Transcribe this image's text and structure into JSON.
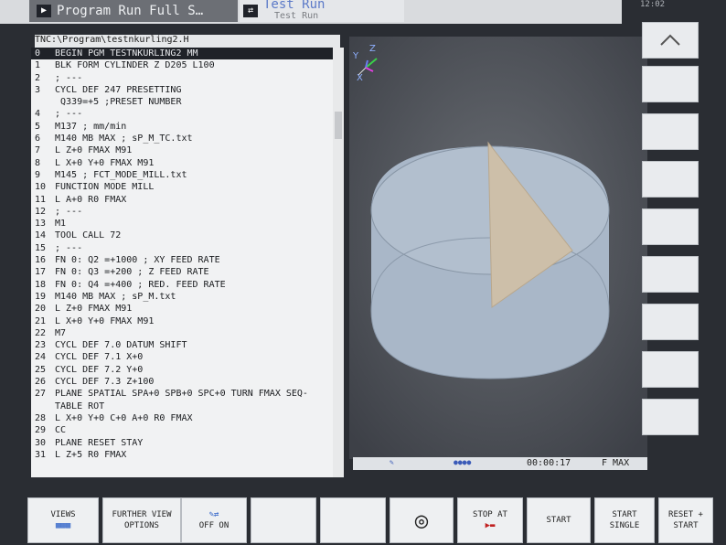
{
  "top": {
    "left_tab": "Program Run Full S…",
    "right_tab": "Test Run",
    "right_sub": "Test Run",
    "clock": "12:02"
  },
  "path": "TNC:\\Program\\testnkurling2.H",
  "program": [
    {
      "n": "0",
      "t": "BEGIN PGM TESTNKURLING2 MM",
      "sel": true
    },
    {
      "n": "1",
      "t": "BLK FORM CYLINDER Z D205 L100"
    },
    {
      "n": "2",
      "t": "; ---"
    },
    {
      "n": "3",
      "t": "CYCL DEF 247 PRESETTING"
    },
    {
      "n": "",
      "t": "  Q339=+5      ;PRESET NUMBER"
    },
    {
      "n": "4",
      "t": "; ---"
    },
    {
      "n": "5",
      "t": "M137 ; mm/min"
    },
    {
      "n": "6",
      "t": "M140 MB MAX ; sP_M_TC.txt"
    },
    {
      "n": "7",
      "t": "L  Z+0 FMAX M91"
    },
    {
      "n": "8",
      "t": "L  X+0  Y+0 FMAX M91"
    },
    {
      "n": "9",
      "t": "M145 ; FCT_MODE_MILL.txt"
    },
    {
      "n": "10",
      "t": "FUNCTION MODE MILL"
    },
    {
      "n": "11",
      "t": "L  A+0 R0 FMAX"
    },
    {
      "n": "12",
      "t": "; ---"
    },
    {
      "n": "13",
      "t": "M1"
    },
    {
      "n": "14",
      "t": "TOOL CALL 72"
    },
    {
      "n": "15",
      "t": "; ---"
    },
    {
      "n": "16",
      "t": "FN 0: Q2 =+1000 ; XY FEED RATE"
    },
    {
      "n": "17",
      "t": "FN 0: Q3 =+200 ; Z FEED RATE"
    },
    {
      "n": "18",
      "t": "FN 0: Q4 =+400 ; RED. FEED RATE"
    },
    {
      "n": "19",
      "t": "M140 MB MAX ; sP_M.txt"
    },
    {
      "n": "20",
      "t": "L  Z+0 FMAX M91"
    },
    {
      "n": "21",
      "t": "L  X+0  Y+0 FMAX M91"
    },
    {
      "n": "22",
      "t": "M7"
    },
    {
      "n": "23",
      "t": "CYCL DEF 7.0 DATUM SHIFT"
    },
    {
      "n": "24",
      "t": "CYCL DEF 7.1  X+0"
    },
    {
      "n": "25",
      "t": "CYCL DEF 7.2  Y+0"
    },
    {
      "n": "26",
      "t": "CYCL DEF 7.3  Z+100"
    },
    {
      "n": "27",
      "t": "PLANE SPATIAL SPA+0 SPB+0 SPC+0 TURN FMAX SEQ-"
    },
    {
      "n": "",
      "t": "TABLE ROT"
    },
    {
      "n": "28",
      "t": "L  X+0  Y+0  C+0  A+0 R0 FMAX"
    },
    {
      "n": "29",
      "t": "CC"
    },
    {
      "n": "30",
      "t": "PLANE RESET STAY"
    },
    {
      "n": "31",
      "t": "L  Z+5 R0 FMAX"
    }
  ],
  "status": {
    "time": "00:00:17",
    "feed": "F MAX"
  },
  "softkeys": [
    {
      "id": "views",
      "label": "VIEWS"
    },
    {
      "id": "further",
      "label": "FURTHER VIEW OPTIONS"
    },
    {
      "id": "toggle",
      "label": "OFF   ON"
    },
    {
      "id": "blank1",
      "label": ""
    },
    {
      "id": "blank2",
      "label": ""
    },
    {
      "id": "override",
      "label": ""
    },
    {
      "id": "stop",
      "label": "STOP AT"
    },
    {
      "id": "start",
      "label": "START"
    },
    {
      "id": "start_single",
      "label": "START SINGLE"
    },
    {
      "id": "reset_start",
      "label": "RESET + START"
    }
  ],
  "axis_labels": {
    "y": "Y",
    "z": "Z",
    "x": "X"
  }
}
